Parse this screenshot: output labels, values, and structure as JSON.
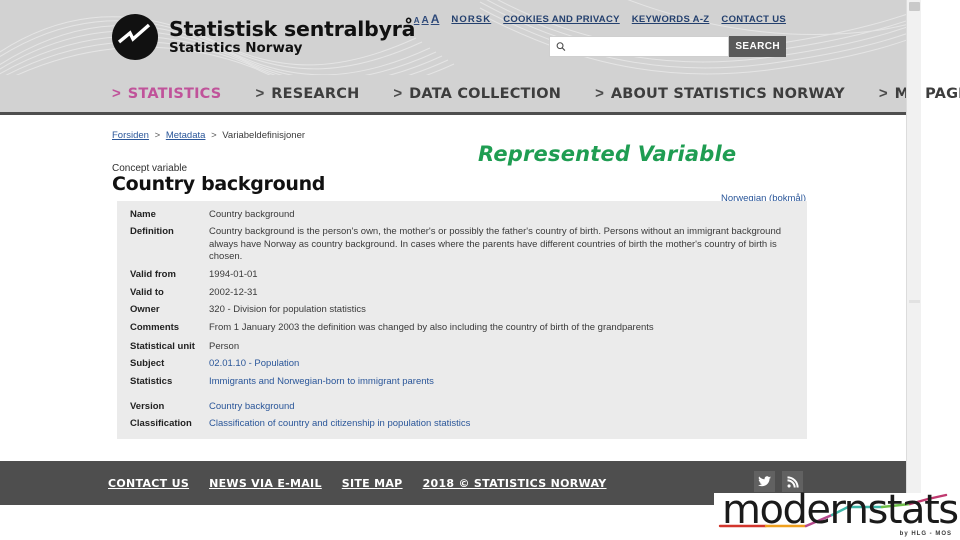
{
  "site": {
    "logo_title": "Statistisk sentralbyrå",
    "logo_subtitle": "Statistics Norway",
    "logo_icon": "statistics-norway-logo-icon"
  },
  "utility_nav": {
    "text_size_small": "A",
    "text_size_medium": "A",
    "text_size_large": "A",
    "links": [
      {
        "label": "NORSK"
      },
      {
        "label": "COOKIES AND PRIVACY"
      },
      {
        "label": "KEYWORDS A-Z"
      },
      {
        "label": "CONTACT US"
      }
    ]
  },
  "search": {
    "value": "",
    "placeholder": "",
    "button_label": "SEARCH",
    "icon": "search-icon"
  },
  "main_nav": {
    "chevron": ">",
    "active_color": "#c0539a",
    "items": [
      {
        "label": "STATISTICS",
        "active": true
      },
      {
        "label": "RESEARCH",
        "active": false
      },
      {
        "label": "DATA COLLECTION",
        "active": false
      },
      {
        "label": "ABOUT STATISTICS NORWAY",
        "active": false
      },
      {
        "label": "MY PAGE",
        "active": false
      }
    ]
  },
  "breadcrumb": {
    "items": [
      {
        "label": "Forsiden",
        "link": true
      },
      {
        "label": "Metadata",
        "link": true
      },
      {
        "label": "Variabeldefinisjoner",
        "link": false
      }
    ],
    "separator": ">"
  },
  "annotation": {
    "label": "Represented Variable",
    "color": "#1f9d52"
  },
  "page": {
    "kicker": "Concept variable",
    "title": "Country background",
    "language_link": "Norwegian (bokmål)"
  },
  "detail_table": {
    "rows": [
      {
        "key": "Name",
        "value": "Country background",
        "link": false
      },
      {
        "key": "Definition",
        "value": "Country background is the person's own, the mother's or possibly the father's country of birth. Persons without an immigrant background always have Norway as country background. In cases where the parents have different countries of birth the mother's country of birth is chosen.",
        "link": false
      },
      {
        "key": "Valid from",
        "value": "1994-01-01",
        "link": false
      },
      {
        "key": "Valid to",
        "value": "2002-12-31",
        "link": false
      },
      {
        "key": "Owner",
        "value": "320 - Division for population statistics",
        "link": false
      },
      {
        "key": "Comments",
        "value": "From 1 January 2003 the definition was changed by also including the country of birth of the grandparents",
        "link": false
      }
    ]
  },
  "context_table": {
    "rows": [
      {
        "key": "Statistical unit",
        "value": "Person",
        "link": false
      },
      {
        "key": "Subject",
        "value": "02.01.10 - Population",
        "link": true
      },
      {
        "key": "Statistics",
        "value": "Immigrants and Norwegian-born to immigrant parents",
        "link": true
      }
    ]
  },
  "version_table": {
    "rows": [
      {
        "key": "Version",
        "value": "Country background",
        "link": true
      },
      {
        "key": "Classification",
        "value": "Classification of country and citizenship in population statistics",
        "link": true
      }
    ]
  },
  "footer": {
    "links": [
      {
        "label": "CONTACT US"
      },
      {
        "label": "NEWS VIA E-MAIL"
      },
      {
        "label": "SITE MAP"
      },
      {
        "label": "2018 © STATISTICS NORWAY"
      }
    ],
    "social": [
      {
        "name": "twitter-icon"
      },
      {
        "name": "rss-icon"
      }
    ]
  },
  "watermark": {
    "word_dark_1": "mo",
    "word_dark_2": "dern",
    "word_dark_3": "stats",
    "full_word": "modernstats",
    "subtitle": "by HLG - MOS"
  }
}
